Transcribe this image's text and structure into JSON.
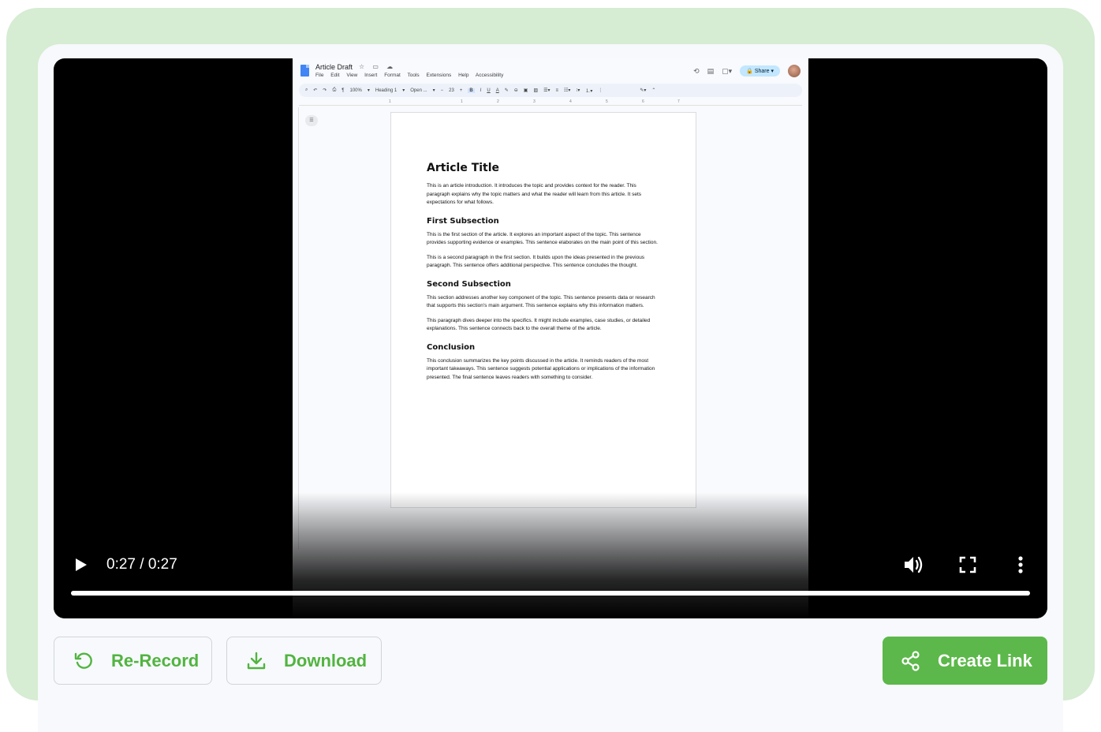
{
  "doc": {
    "title": "Article Draft",
    "menu": [
      "File",
      "Edit",
      "View",
      "Insert",
      "Format",
      "Tools",
      "Extensions",
      "Help",
      "Accessibility"
    ],
    "share_label": "Share",
    "zoom": "100%",
    "style": "Heading 1",
    "font": "Open ...",
    "font_size": "23",
    "ruler_marks": [
      "1",
      "1",
      "2",
      "3",
      "4",
      "5",
      "6",
      "7"
    ],
    "content": {
      "title": "Article Title",
      "intro": "This is an article introduction. It introduces the topic and provides context for the reader. This paragraph explains why the topic matters and what the reader will learn from this article. It sets expectations for what follows.",
      "h_first": "First Subsection",
      "p_first_1": "This is the first section of the article. It explores an important aspect of the topic. This sentence provides supporting evidence or examples. This sentence elaborates on the main point of this section.",
      "p_first_2": "This is a second paragraph in the first section. It builds upon the ideas presented in the previous paragraph. This sentence offers additional perspective. This sentence concludes the thought.",
      "h_second": "Second Subsection",
      "p_second_1": "This section addresses another key component of the topic. This sentence presents data or research that supports this section's main argument. This sentence explains why this information matters.",
      "p_second_2": "This paragraph dives deeper into the specifics. It might include examples, case studies, or detailed explanations. This sentence connects back to the overall theme of the article.",
      "h_conclusion": "Conclusion",
      "p_conclusion": "This conclusion summarizes the key points discussed in the article. It reminds readers of the most important takeaways. This sentence suggests potential applications or implications of the information presented. The final sentence leaves readers with something to consider."
    }
  },
  "video": {
    "time_label": "0:27 / 0:27",
    "progress_fraction": 1.0,
    "icons": {
      "play": "play-icon",
      "volume": "volume-icon",
      "fullscreen": "fullscreen-icon",
      "more": "more-vert-icon"
    }
  },
  "actions": {
    "rerecord_label": "Re-Record",
    "download_label": "Download",
    "create_link_label": "Create Link"
  },
  "colors": {
    "accent": "#5cb84a",
    "frame": "#d6ecd3",
    "player_bg": "#000000"
  }
}
